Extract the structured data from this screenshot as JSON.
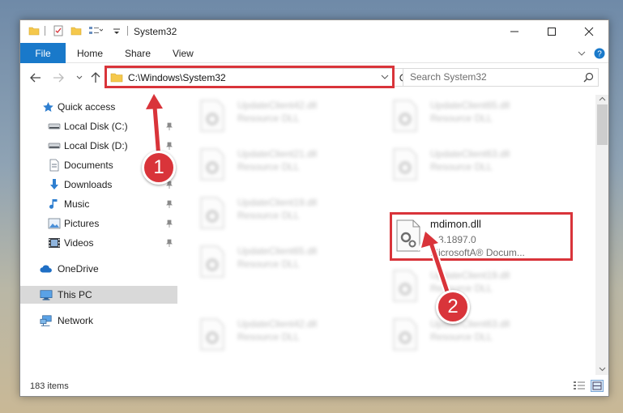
{
  "window": {
    "title": "System32",
    "caption": {
      "minimize": "—",
      "maximize": "☐",
      "close": "✕"
    }
  },
  "ribbon": {
    "tabs": [
      "File",
      "Home",
      "Share",
      "View"
    ],
    "collapse": "⌄",
    "help": "?"
  },
  "address": {
    "path": "C:\\Windows\\System32",
    "search_placeholder": "Search System32"
  },
  "nav": {
    "quick_access": "Quick access",
    "items": [
      {
        "label": "Local Disk (C:)",
        "icon": "drive-icon"
      },
      {
        "label": "Local Disk (D:)",
        "icon": "drive-icon"
      },
      {
        "label": "Documents",
        "icon": "documents-icon"
      },
      {
        "label": "Downloads",
        "icon": "download-icon"
      },
      {
        "label": "Music",
        "icon": "music-icon"
      },
      {
        "label": "Pictures",
        "icon": "pictures-icon"
      },
      {
        "label": "Videos",
        "icon": "videos-icon"
      }
    ],
    "onedrive": "OneDrive",
    "thispc": "This PC",
    "network": "Network"
  },
  "files": {
    "blurred": [
      {
        "name": "UpdateClient42.dll",
        "desc": "Resource DLL"
      },
      {
        "name": "UpdateClient65.dll",
        "desc": "Resource DLL"
      },
      {
        "name": "UpdateClient21.dll",
        "desc": "Resource DLL"
      },
      {
        "name": "UpdateClient63.dll",
        "desc": "Resource DLL"
      },
      {
        "name": "UpdateClient19.dll",
        "desc": "Resource DLL"
      },
      {
        "name": "UpdateClient65.dll",
        "desc": "Resource DLL"
      },
      {
        "name": "UpdateClient19.dll",
        "desc": "Resource DLL"
      },
      {
        "name": "UpdateClient42.dll",
        "desc": "Resource DLL"
      },
      {
        "name": "UpdateClient63.dll",
        "desc": "Resource DLL"
      }
    ],
    "target": {
      "name": "mdimon.dll",
      "version": "0.3.1897.0",
      "company": "MicrosoftA® Docum..."
    }
  },
  "status": {
    "items": "183 items"
  },
  "callouts": {
    "one": "1",
    "two": "2"
  },
  "colors": {
    "accent": "#1979ca",
    "highlight": "#d9343a",
    "folder": "#f5c84c"
  }
}
